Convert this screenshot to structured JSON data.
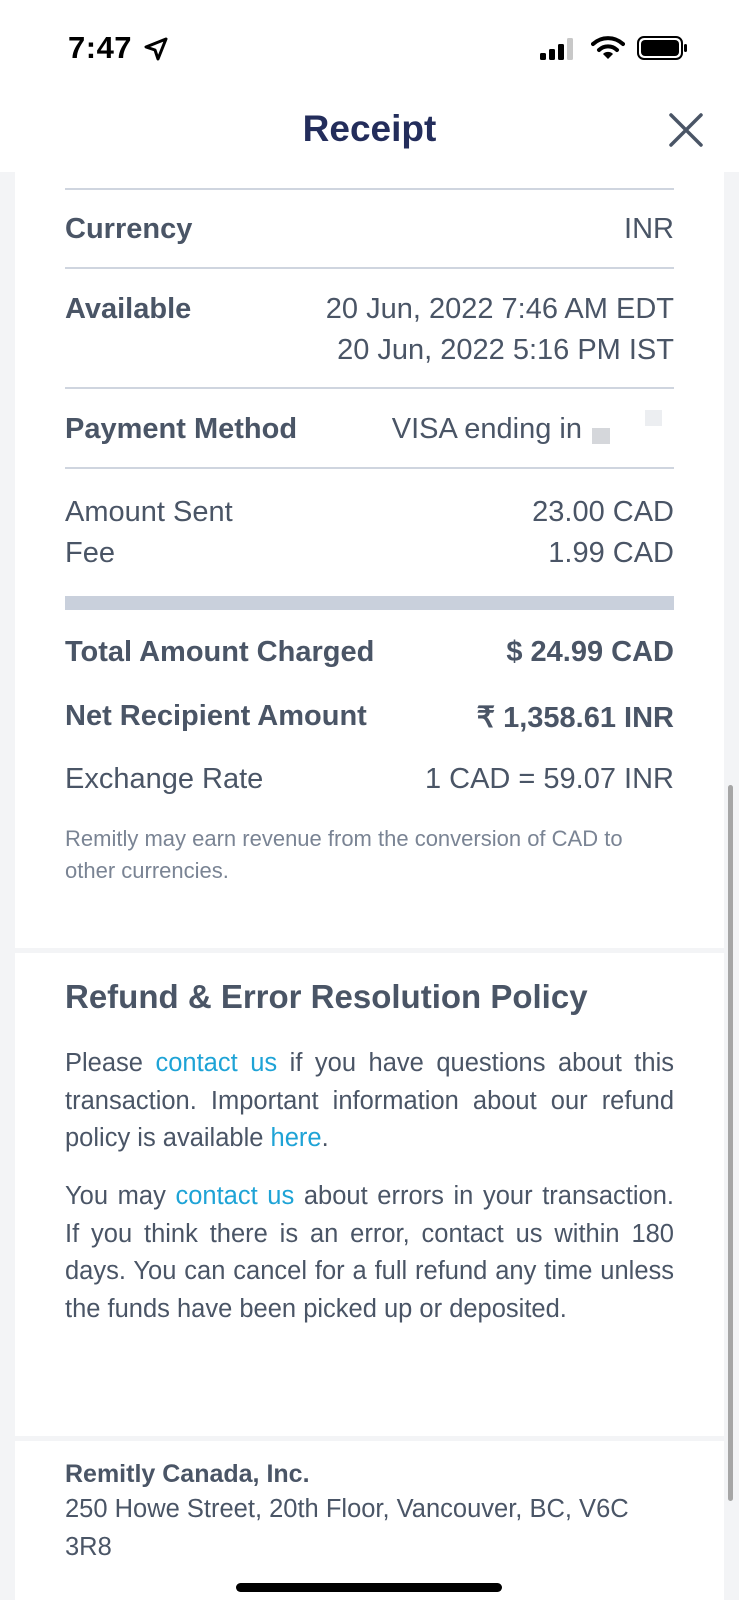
{
  "status_bar": {
    "time": "7:47"
  },
  "nav": {
    "title": "Receipt"
  },
  "details": {
    "currency_label": "Currency",
    "currency_value": "INR",
    "available_label": "Available",
    "available_line1": "20 Jun, 2022 7:46 AM EDT",
    "available_line2": "20 Jun, 2022 5:16 PM IST",
    "payment_label": "Payment Method",
    "payment_value": "VISA ending in",
    "amount_sent_label": "Amount Sent",
    "amount_sent_value": "23.00 CAD",
    "fee_label": "Fee",
    "fee_value": "1.99 CAD",
    "total_label": "Total Amount Charged",
    "total_value": "$ 24.99 CAD",
    "net_label": "Net Recipient Amount",
    "net_value": "₹ 1,358.61 INR",
    "rate_label": "Exchange Rate",
    "rate_value": "1 CAD = 59.07 INR",
    "disclaimer": "Remitly may earn revenue from the conversion of CAD to other currencies."
  },
  "policy": {
    "title": "Refund & Error Resolution Policy",
    "p1_a": "Please ",
    "p1_link": "contact us",
    "p1_b": " if you have questions about this transaction. Important information about our refund policy is available ",
    "p1_link2": "here",
    "p1_c": ".",
    "p2_a": "You may ",
    "p2_link": "contact us",
    "p2_b": " about errors in your transaction. If you think there is an error, contact us within 180 days. You can cancel for a full refund any time unless the funds have been picked up or deposited."
  },
  "company": {
    "name": "Remitly Canada, Inc.",
    "address": "250 Howe Street, 20th Floor, Vancouver, BC, V6C 3R8"
  },
  "colors": {
    "title_navy": "#232d5b",
    "link_blue": "#1ea3d6",
    "text_gray": "#4a5566"
  }
}
